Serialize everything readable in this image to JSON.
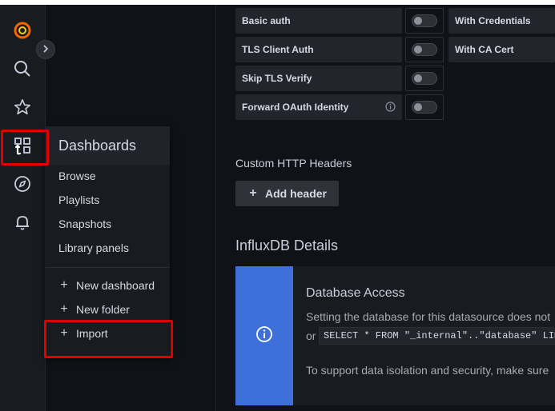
{
  "sidebar": {
    "items": [
      {
        "name": "grafana-logo-icon"
      },
      {
        "name": "search-icon"
      },
      {
        "name": "star-icon"
      },
      {
        "name": "dashboards-icon"
      },
      {
        "name": "compass-icon"
      },
      {
        "name": "bell-icon"
      }
    ]
  },
  "auth": {
    "basic_auth": "Basic auth",
    "tls_client_auth": "TLS Client Auth",
    "skip_tls_verify": "Skip TLS Verify",
    "forward_oauth": "Forward OAuth Identity",
    "with_credentials": "With Credentials",
    "with_ca_cert": "With CA Cert"
  },
  "headers": {
    "title": "Custom HTTP Headers",
    "add_button": "Add header"
  },
  "influx": {
    "title": "InfluxDB Details",
    "alert_title": "Database Access",
    "alert_text": "Setting the database for this datasource does not",
    "alert_or": "or",
    "alert_code": "SELECT * FROM \"_internal\"..\"database\" LIM",
    "alert_text2": "To support data isolation and security, make sure"
  },
  "flyout": {
    "title": "Dashboards",
    "items": [
      "Browse",
      "Playlists",
      "Snapshots",
      "Library panels"
    ],
    "actions": [
      "New dashboard",
      "New folder",
      "Import"
    ]
  },
  "colors": {
    "highlight": "#e00000",
    "info_blue": "#3d71d9",
    "logo_orange": "#f46800"
  }
}
